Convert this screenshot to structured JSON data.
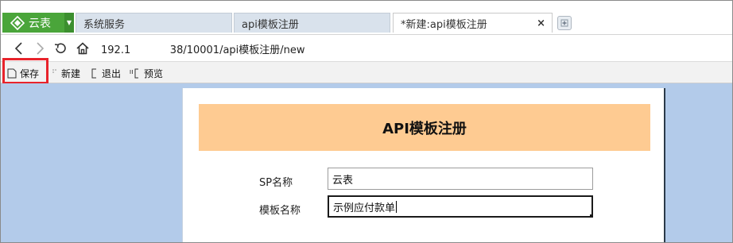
{
  "brand": {
    "label": "云表",
    "color": "#4aa53a"
  },
  "tabs": [
    {
      "label": "系统服务"
    },
    {
      "label": "api模板注册"
    },
    {
      "label": "*新建:api模板注册",
      "close": "×"
    }
  ],
  "address": {
    "url": "192.1            38/10001/api模板注册/new"
  },
  "toolbar": {
    "save": "保存",
    "new": "新建",
    "exit": "退出",
    "preview": "预览"
  },
  "form": {
    "title": "API模板注册",
    "sp_name_label": "SP名称",
    "sp_name_value": "云表",
    "template_name_label": "模板名称",
    "template_name_value": "示例应付款单"
  },
  "colors": {
    "header_band": "#fecb92",
    "content_bg": "#b3cbea",
    "highlight": "#e8232b"
  },
  "icons": [
    "brand-logo-icon",
    "dropdown-icon",
    "close-icon",
    "add-tab-icon",
    "back-icon",
    "forward-icon",
    "reload-icon",
    "home-icon",
    "save-icon",
    "new-icon",
    "exit-icon",
    "preview-icon"
  ]
}
